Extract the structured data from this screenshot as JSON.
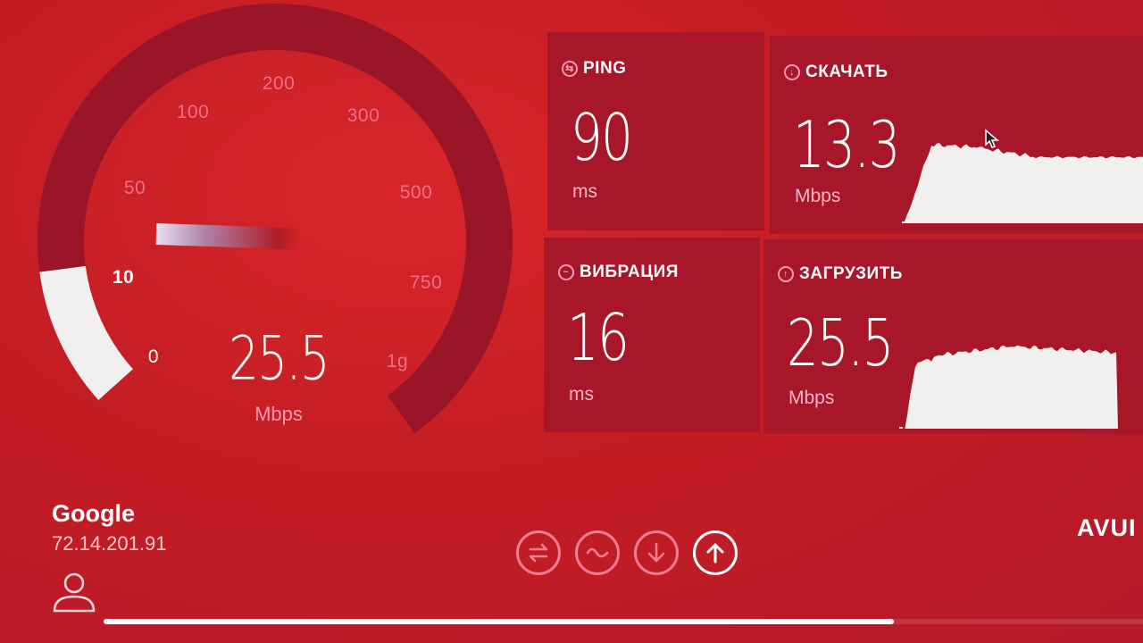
{
  "gauge": {
    "ticks": [
      "0",
      "10",
      "50",
      "100",
      "200",
      "300",
      "500",
      "750",
      "1g"
    ],
    "active_tick": "10",
    "value": "25.5",
    "unit": "Mbps",
    "fill_fraction": 0.125
  },
  "ping": {
    "label": "PING",
    "value": "90",
    "unit": "ms"
  },
  "download": {
    "label": "СКАЧАТЬ",
    "value": "13.3",
    "unit": "Mbps"
  },
  "jitter": {
    "label": "ВИБРАЦИЯ",
    "value": "16",
    "unit": "ms"
  },
  "upload": {
    "label": "ЗАГРУЗИТЬ",
    "value": "25.5",
    "unit": "Mbps"
  },
  "server": {
    "name": "Google",
    "ip": "72.14.201.91"
  },
  "progress": 0.76,
  "steps": [
    {
      "name": "ping-step",
      "icon": "ping-icon",
      "active": false
    },
    {
      "name": "jitter-step",
      "icon": "jitter-icon",
      "active": false
    },
    {
      "name": "download-step",
      "icon": "download-icon",
      "active": false
    },
    {
      "name": "upload-step",
      "icon": "upload-icon",
      "active": true
    }
  ],
  "brand": "AVUI",
  "colors": {
    "background": "#c31d24",
    "card": "#a8162a",
    "accent": "#f06f86",
    "fill": "#f2f0ee"
  }
}
